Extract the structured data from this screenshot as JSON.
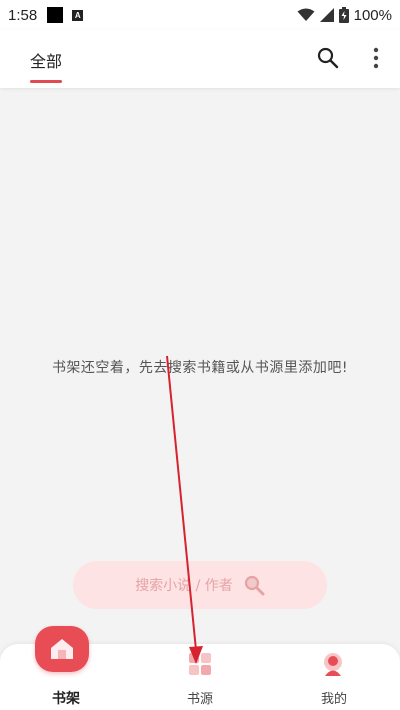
{
  "status_bar": {
    "time": "1:58",
    "battery": "100%"
  },
  "top_bar": {
    "tab_all": "全部",
    "accent_color": "#e04a50"
  },
  "empty_state": {
    "message": "书架还空着，先去搜索书籍或从书源里添加吧!"
  },
  "search_button": {
    "label": "搜索小说 / 作者"
  },
  "bottom_nav": {
    "items": [
      {
        "label": "书架",
        "icon": "bookshelf-home-icon",
        "active": true
      },
      {
        "label": "书源",
        "icon": "book-source-grid-icon",
        "active": false
      },
      {
        "label": "我的",
        "icon": "profile-person-icon",
        "active": false
      }
    ]
  },
  "colors": {
    "accent": "#e84d55",
    "pill_bg": "#fde3e3",
    "annotation_arrow": "#d6232f"
  }
}
